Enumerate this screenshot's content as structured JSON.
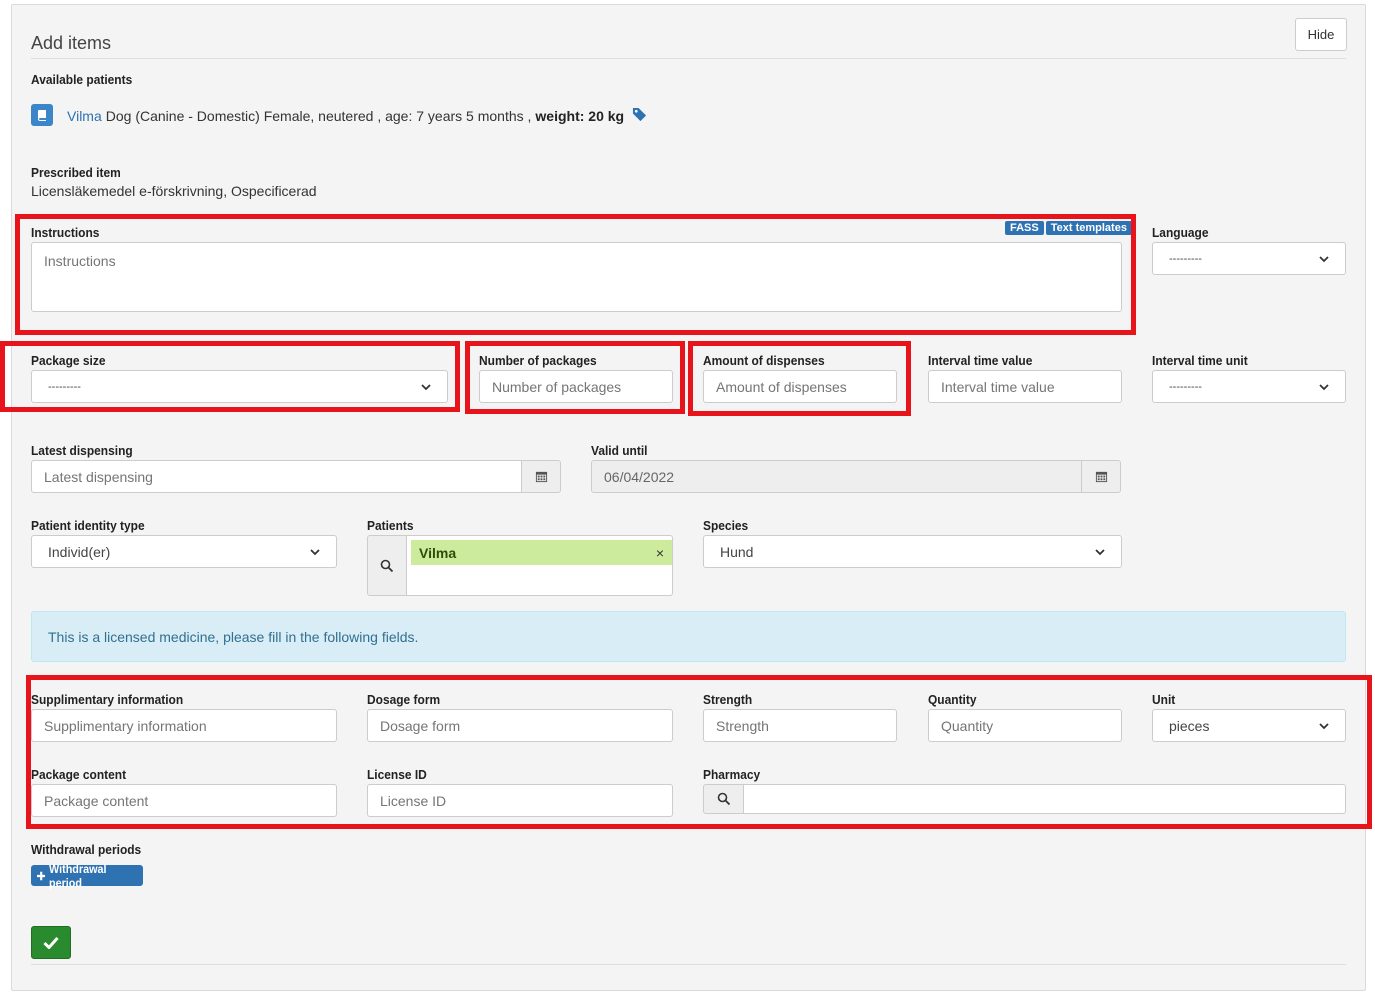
{
  "header": {
    "title": "Add items",
    "hide_label": "Hide"
  },
  "patients": {
    "label": "Available patients",
    "name": "Vilma",
    "description": "Dog (Canine - Domestic) Female, neutered , age: 7 years 5 months ,",
    "weight": "weight: 20 kg"
  },
  "prescribed": {
    "label": "Prescribed item",
    "value": "Licensläkemedel e-förskrivning, Ospecificerad"
  },
  "instructions": {
    "label": "Instructions",
    "placeholder": "Instructions",
    "badges": [
      "FASS",
      "Text templates"
    ]
  },
  "language": {
    "label": "Language",
    "value": "---------"
  },
  "package_size": {
    "label": "Package size",
    "value": "---------"
  },
  "number_of_packages": {
    "label": "Number of packages",
    "placeholder": "Number of packages"
  },
  "amount_of_dispenses": {
    "label": "Amount of dispenses",
    "placeholder": "Amount of dispenses"
  },
  "interval_time_value": {
    "label": "Interval time value",
    "placeholder": "Interval time value"
  },
  "interval_time_unit": {
    "label": "Interval time unit",
    "value": "---------"
  },
  "latest_dispensing": {
    "label": "Latest dispensing",
    "placeholder": "Latest dispensing"
  },
  "valid_until": {
    "label": "Valid until",
    "value": "06/04/2022"
  },
  "patient_identity_type": {
    "label": "Patient identity type",
    "value": "Individ(er)"
  },
  "patients_field": {
    "label": "Patients",
    "chip": "Vilma",
    "remove": "×"
  },
  "species": {
    "label": "Species",
    "value": "Hund"
  },
  "alert": {
    "text": "This is a licensed medicine, please fill in the following fields."
  },
  "supplementary": {
    "label": "Supplimentary information",
    "placeholder": "Supplimentary information"
  },
  "dosage_form": {
    "label": "Dosage form",
    "placeholder": "Dosage form"
  },
  "strength": {
    "label": "Strength",
    "placeholder": "Strength"
  },
  "quantity": {
    "label": "Quantity",
    "placeholder": "Quantity"
  },
  "unit": {
    "label": "Unit",
    "value": "pieces"
  },
  "package_content": {
    "label": "Package content",
    "placeholder": "Package content"
  },
  "license_id": {
    "label": "License ID",
    "placeholder": "License ID"
  },
  "pharmacy": {
    "label": "Pharmacy"
  },
  "withdrawal": {
    "label": "Withdrawal periods",
    "button": "Withdrawal period"
  },
  "colors": {
    "accent": "#2e72b3",
    "highlight": "#e8141c",
    "success": "#2a8a2e",
    "alert_bg": "#d9edf7"
  },
  "icons": [
    "book-icon",
    "tag-icon",
    "calendar-icon",
    "search-icon",
    "plus-icon",
    "check-icon",
    "chevron-down-icon"
  ]
}
